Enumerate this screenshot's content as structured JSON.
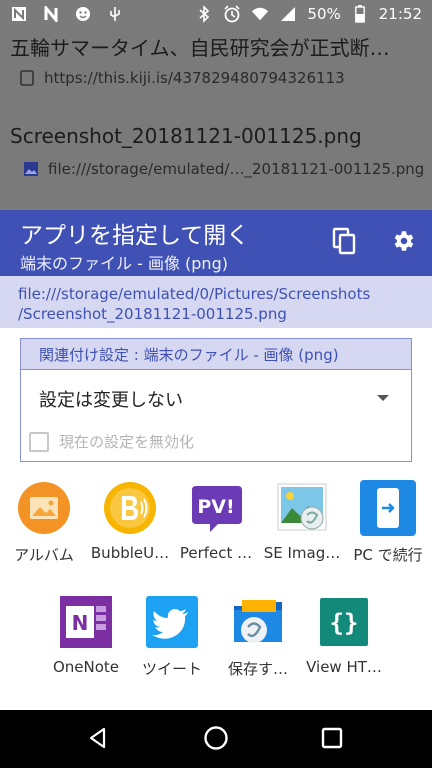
{
  "status_bar": {
    "left_icons": [
      "n-app-icon",
      "n-letter-icon",
      "face-icon",
      "usb-icon"
    ],
    "right_icons": [
      "bluetooth-icon",
      "alarm-icon",
      "wifi-icon",
      "signal-icon",
      "battery-icon"
    ],
    "battery": "50%",
    "time": "21:52"
  },
  "background_list": {
    "items": [
      {
        "title": "五輪サマータイム、自民研究会が正式断…",
        "url": "https://this.kiji.is/437829480794326113"
      },
      {
        "title": "Screenshot_20181121-001125.png",
        "url": "file:///storage/emulated/…_20181121-001125.png"
      }
    ]
  },
  "header": {
    "title": "アプリを指定して開く",
    "subtitle": "端末のファイル - 画像 (png)"
  },
  "url_bar": {
    "line1": "file:///storage/emulated/0/Pictures/Screenshots",
    "line2": "/Screenshot_20181121-001125.png"
  },
  "association": {
    "heading": "関連付け設定 : 端末のファイル - 画像 (png)",
    "selected": "設定は変更しない",
    "checkbox_label": "現在の設定を無効化"
  },
  "apps": [
    {
      "label": "アルバム"
    },
    {
      "label": "BubbleU…"
    },
    {
      "label": "Perfect …"
    },
    {
      "label": "SE Imag…"
    },
    {
      "label": "PC で続行"
    },
    {
      "label": "OneNote"
    },
    {
      "label": "ツイート"
    },
    {
      "label": "保存す…"
    },
    {
      "label": "View HT…"
    }
  ],
  "colors": {
    "accent": "#3f51b5",
    "accent_light": "#d5d8f0"
  }
}
